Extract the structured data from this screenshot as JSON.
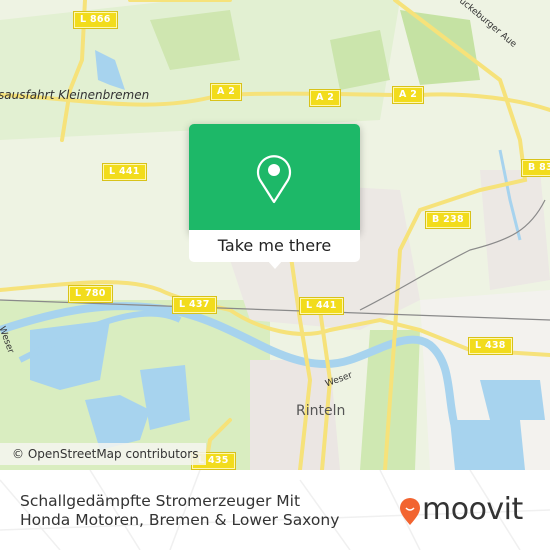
{
  "map": {
    "road_shields": [
      {
        "id": "l866",
        "label": "L 866"
      },
      {
        "id": "a2-west",
        "label": "A 2"
      },
      {
        "id": "a2-mid",
        "label": "A 2"
      },
      {
        "id": "a2-east",
        "label": "A 2"
      },
      {
        "id": "l441-north",
        "label": "L 441"
      },
      {
        "id": "b83",
        "label": "B 83"
      },
      {
        "id": "b238",
        "label": "B 238"
      },
      {
        "id": "l780",
        "label": "L 780"
      },
      {
        "id": "l437",
        "label": "L 437"
      },
      {
        "id": "l441-south",
        "label": "L 441"
      },
      {
        "id": "l438",
        "label": "L 438"
      },
      {
        "id": "l435",
        "label": "L 435"
      }
    ],
    "place_labels": {
      "exit": "sausfahrt Kleinenbremen",
      "town": "Rinteln",
      "river_weser_1": "Weser",
      "river_weser_2": "Weser",
      "stream": "ückeburger Aue"
    },
    "attribution": "© OpenStreetMap contributors",
    "colors": {
      "water": "#a7d3ee",
      "forest": "#c8e6a8",
      "grass": "#dcefc5",
      "road": "#f6e27a",
      "shield": "#f2dc1c",
      "popup": "#1db868"
    }
  },
  "popup": {
    "icon": "map-pin-icon",
    "button_label": "Take me there"
  },
  "footer": {
    "title": "Schallgedämpfte Stromerzeuger Mit Honda Motoren, Bremen & Lower Saxony",
    "logo_text": "moovit",
    "logo_color": "#f26430"
  }
}
